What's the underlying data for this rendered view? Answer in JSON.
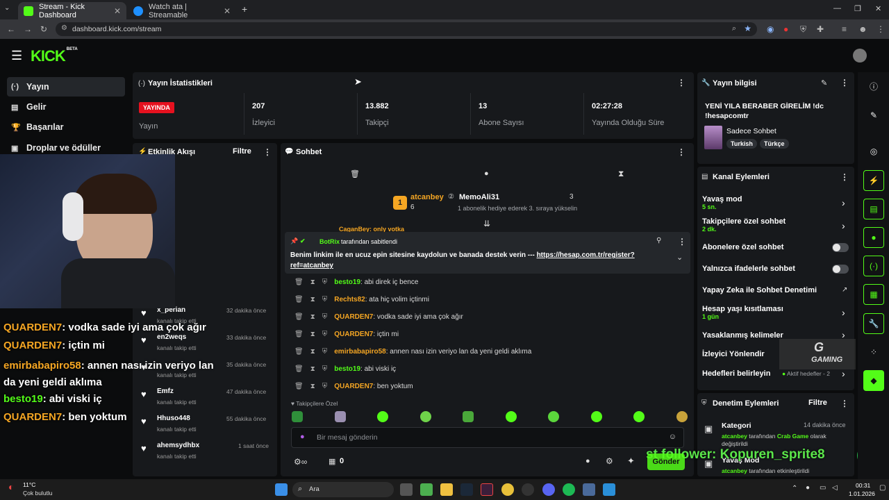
{
  "browser": {
    "tabs": [
      {
        "title": "Stream - Kick Dashboard",
        "active": true
      },
      {
        "title": "Watch ata | Streamable",
        "active": false
      }
    ],
    "url": "dashboard.kick.com/stream"
  },
  "brand": {
    "logo": "KICK",
    "beta": "BETA",
    "accent": "#53fc18"
  },
  "sidebar": {
    "items": [
      {
        "label": "Yayın",
        "icon": "broadcast-icon",
        "glyph": "(·)"
      },
      {
        "label": "Gelir",
        "icon": "wallet-icon",
        "glyph": "▤"
      },
      {
        "label": "Başarılar",
        "icon": "trophy-icon",
        "glyph": "🏆"
      },
      {
        "label": "Droplar ve ödüller",
        "icon": "gift-icon",
        "glyph": "▣"
      }
    ]
  },
  "stats": {
    "title": "Yayın İstatistikleri",
    "live_badge": "YAYINDA",
    "live_label": "Yayın",
    "items": [
      {
        "value": "207",
        "label": "İzleyici"
      },
      {
        "value": "13.882",
        "label": "Takipçi"
      },
      {
        "value": "13",
        "label": "Abone Sayısı"
      },
      {
        "value": "02:27:28",
        "label": "Yayında Olduğu Süre"
      }
    ]
  },
  "activity": {
    "title": "Etkinlik Akışı",
    "filter": "Filtre",
    "items": [
      {
        "name": "x_perian",
        "sub": "kanalı takip etti",
        "time": "32 dakika önce"
      },
      {
        "name": "en2weqs",
        "sub": "kanalı takip etti",
        "time": "33 dakika önce"
      },
      {
        "name": "",
        "sub": "kanalı takip etti",
        "time": "35 dakika önce"
      },
      {
        "name": "Emfz",
        "sub": "kanalı takip etti",
        "time": "47 dakika önce"
      },
      {
        "name": "Hhuso448",
        "sub": "kanalı takip etti",
        "time": "55 dakika önce"
      },
      {
        "name": "ahemsydhbx",
        "sub": "kanalı takip etti",
        "time": "1 saat önce"
      }
    ]
  },
  "chat": {
    "title": "Sohbet",
    "leader1": {
      "rank": "1",
      "name": "atcanbey",
      "count": "6"
    },
    "leader2": {
      "name": "MemoAli31",
      "count": "3",
      "note": "1 abonelik hediye ederek 3. sıraya yükselin"
    },
    "partial": "CaganBey: only votka",
    "pinned": {
      "by": "BotRix",
      "by_suffix": "tarafından sabitlendi",
      "text": "Benim linkim ile en ucuz epin sitesine kaydolun ve banada destek verin ---",
      "link": "https://hesap.com.tr/register?ref=atcanbey"
    },
    "messages": [
      {
        "user": "besto19",
        "color": "g",
        "text": "abi direk iç bence"
      },
      {
        "user": "Rechts82",
        "color": "o",
        "text": "ata hiç volim içtinmi"
      },
      {
        "user": "QUARDEN7",
        "color": "o",
        "text": "vodka sade iyi ama çok ağır"
      },
      {
        "user": "QUARDEN7",
        "color": "o",
        "text": "içtin mi"
      },
      {
        "user": "emirbabapiro58",
        "color": "o",
        "text": "annen nası izin veriyo lan da yeni geldi aklıma"
      },
      {
        "user": "besto19",
        "color": "g",
        "text": "abi viski iç"
      },
      {
        "user": "QUARDEN7",
        "color": "o",
        "text": "ben yoktum"
      }
    ],
    "followers_only": "Takipçilere Özel",
    "placeholder": "Bir mesaj gönderin",
    "bottom_count": "0",
    "send": "Gönder"
  },
  "streaminfo": {
    "title": "Yayın bilgisi",
    "stream_title": "YENİ YILA BERABER GİRELİM !dc !hesapcomtr",
    "category": "Sadece Sohbet",
    "tags": [
      "Turkish",
      "Türkçe"
    ]
  },
  "channel_actions": {
    "title": "Kanal Eylemleri",
    "items": [
      {
        "label": "Yavaş mod",
        "sub": "5 sn.",
        "kind": "chev"
      },
      {
        "label": "Takipçilere özel sohbet",
        "sub": "2 dk.",
        "kind": "chev"
      },
      {
        "label": "Abonelere özel sohbet",
        "sub": "",
        "kind": "toggle"
      },
      {
        "label": "Yalnızca ifadelerle sohbet",
        "sub": "",
        "kind": "toggle"
      },
      {
        "label": "Yapay Zeka ile Sohbet Denetimi",
        "sub": "",
        "kind": "ext"
      },
      {
        "label": "Hesap yaşı kısıtlaması",
        "sub": "1 gün",
        "kind": "chev"
      },
      {
        "label": "Yasaklanmış kelimeler",
        "sub": "",
        "kind": "chev"
      },
      {
        "label": "İzleyici Yönlendir",
        "sub": "",
        "kind": "none"
      },
      {
        "label": "Hedefleri belirleyin",
        "sub": "",
        "kind": "chev"
      }
    ],
    "goal_status": "Aktif hedefler - 2"
  },
  "moderation": {
    "title": "Denetim Eylemleri",
    "filter": "Filtre",
    "items": [
      {
        "label": "Kategori",
        "time": "14 dakika önce",
        "user": "atcanbey",
        "mid": "tarafından",
        "target": "Crab Game",
        "rest": "olarak değiştirildi"
      },
      {
        "label": "Yavaş Mod",
        "user": "atcanbey",
        "mid": "tarafından etkinleştirildi"
      }
    ]
  },
  "overlay": {
    "chat": [
      {
        "user": "QUARDEN7",
        "text": ": vodka sade iyi ama çok ağır"
      },
      {
        "user": "QUARDEN7",
        "text": ": içtin mi"
      },
      {
        "user": "emirbabapiro58",
        "text": ": annen nası izin veriyo lan da yeni geldi aklıma"
      },
      {
        "user": "besto19",
        "text": ": abi viski iç"
      },
      {
        "user": "QUARDEN7",
        "text": ": ben yoktum"
      }
    ],
    "follower_ticker": "st follower: Kopuren_sprite8",
    "watermark": "GAMING"
  },
  "taskbar": {
    "temp": "11°C",
    "weather": "Çok bulutlu",
    "search": "Ara",
    "time": "00:31",
    "date": "1.01.2026"
  }
}
